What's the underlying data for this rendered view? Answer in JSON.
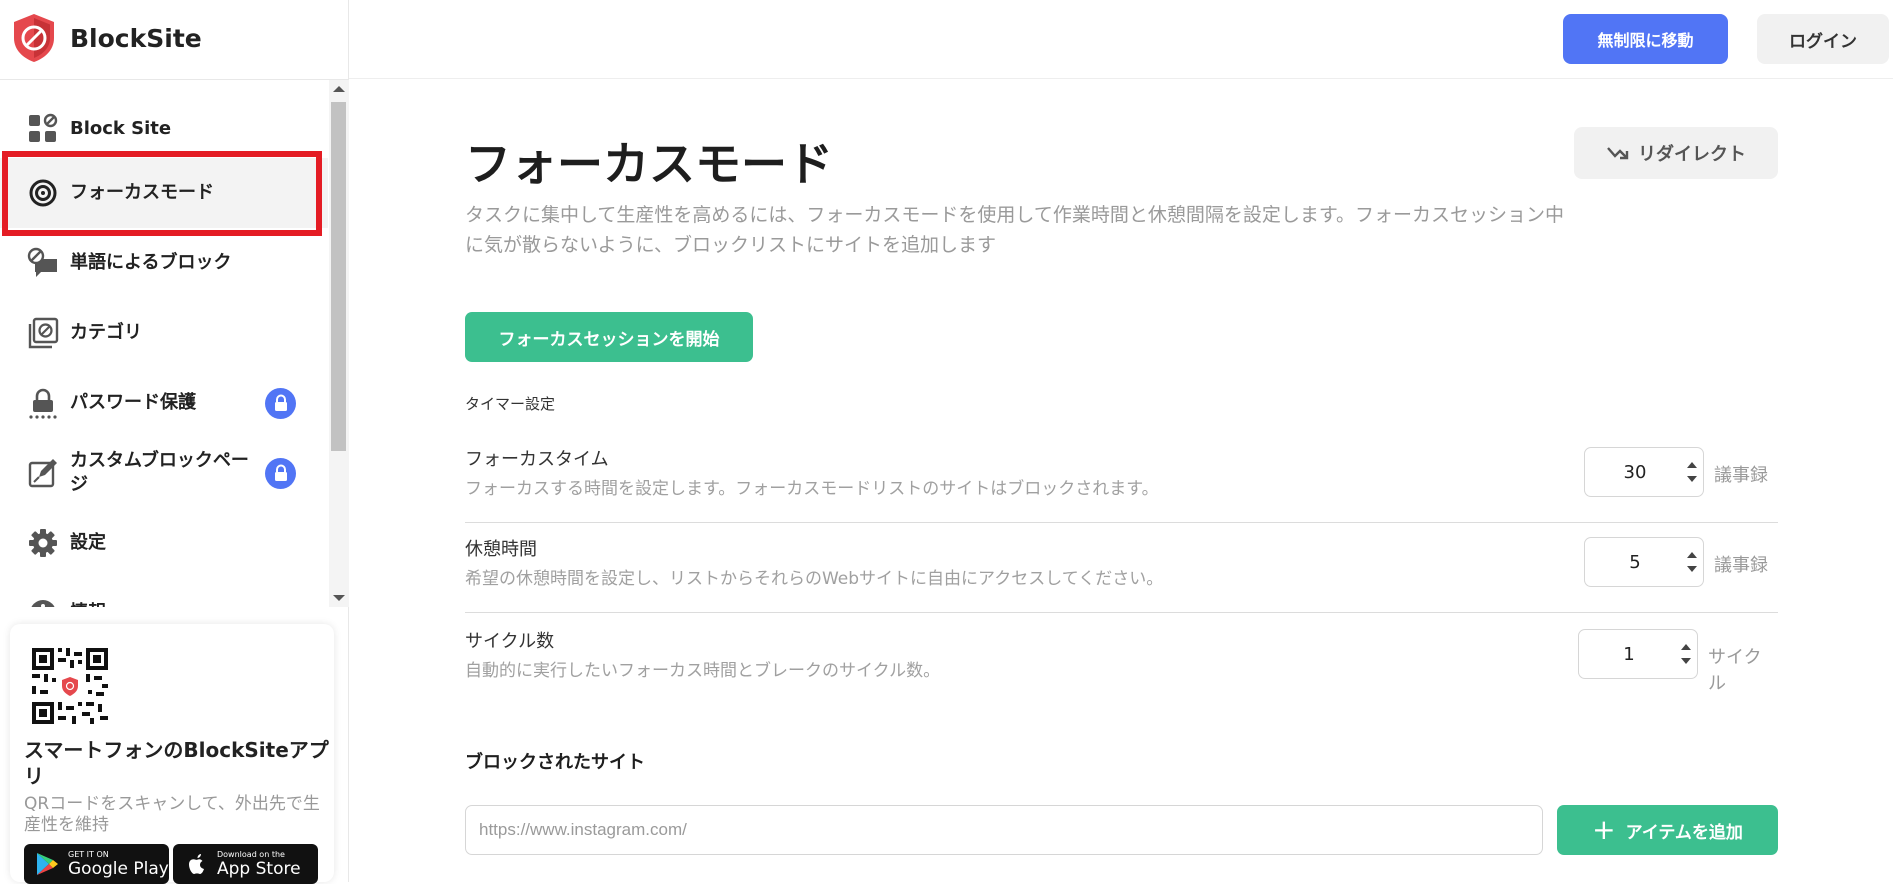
{
  "app": {
    "name": "BlockSite"
  },
  "header": {
    "upgrade_label": "無制限に移動",
    "login_label": "ログイン"
  },
  "sidebar": {
    "items": [
      {
        "label": "Block Site",
        "icon": "block-site-icon"
      },
      {
        "label": "フォーカスモード",
        "icon": "focus-target-icon",
        "active": true
      },
      {
        "label": "単語によるブロック",
        "icon": "word-block-icon"
      },
      {
        "label": "カテゴリ",
        "icon": "category-icon"
      },
      {
        "label": "パスワード保護",
        "icon": "password-icon",
        "locked": true
      },
      {
        "label": "カスタムブロックページ",
        "icon": "custom-page-icon",
        "locked": true
      },
      {
        "label": "設定",
        "icon": "gear-icon"
      },
      {
        "label": "情報",
        "icon": "info-icon"
      }
    ],
    "app_card": {
      "title": "スマートフォンのBlockSiteアプリ",
      "subtitle": "QRコードをスキャンして、外出先で生産性を維持",
      "google_play": {
        "small": "GET IT ON",
        "big": "Google Play"
      },
      "app_store": {
        "small": "Download on the",
        "big": "App Store"
      }
    }
  },
  "main": {
    "title": "フォーカスモード",
    "redirect_label": "リダイレクト",
    "description": "タスクに集中して生産性を高めるには、フォーカスモードを使用して作業時間と休憩間隔を設定します。フォーカスセッション中に気が散らないように、ブロックリストにサイトを追加します",
    "start_button": "フォーカスセッションを開始",
    "timer_heading": "タイマー設定",
    "settings": [
      {
        "title": "フォーカスタイム",
        "desc": "フォーカスする時間を設定します。フォーカスモードリストのサイトはブロックされます。",
        "value": "30",
        "unit": "議事録"
      },
      {
        "title": "休憩時間",
        "desc": "希望の休憩時間を設定し、リストからそれらのWebサイトに自由にアクセスしてください。",
        "value": "5",
        "unit": "議事録"
      },
      {
        "title": "サイクル数",
        "desc": "自動的に実行したいフォーカス時間とブレークのサイクル数。",
        "value": "1",
        "unit": "サイクル"
      }
    ],
    "blocked_heading": "ブロックされたサイト",
    "url_placeholder": "https://www.instagram.com/",
    "add_label": "アイテムを追加"
  },
  "colors": {
    "accent_blue": "#5175f5",
    "accent_green": "#3cbf8f",
    "highlight_red": "#e41c24",
    "logo_red": "#e5484d"
  }
}
